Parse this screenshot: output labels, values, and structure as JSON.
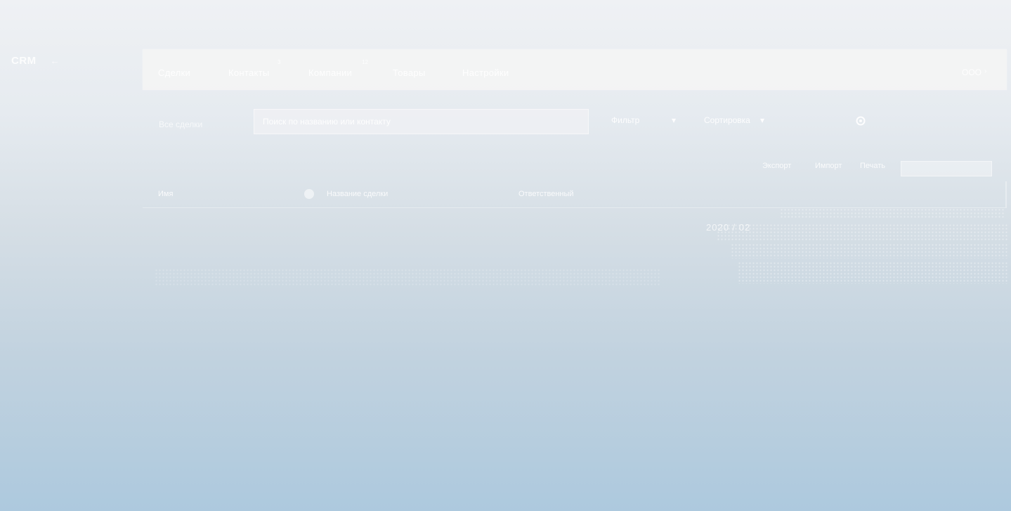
{
  "app": {
    "logo_text": "CRM",
    "logo_arrow": "←"
  },
  "nav": {
    "tabs": [
      {
        "label": "Сделки"
      },
      {
        "label": "Контакты"
      },
      {
        "label": "Компании"
      },
      {
        "label": "Товары"
      },
      {
        "label": "Настройки"
      }
    ],
    "badges": [
      "3",
      "12"
    ],
    "user_label": "ООО",
    "user_caret": "›"
  },
  "toolbar": {
    "label": "Все сделки",
    "search_placeholder": "Поиск по названию или контакту",
    "filter_label": "Фильтр",
    "filter_caret": "▾",
    "sort_label": "Сортировка",
    "sort_caret": "▾",
    "settings_icon": "gear-icon"
  },
  "subbar": {
    "links": [
      "Экспорт",
      "Импорт",
      "Печать"
    ],
    "button_label": ""
  },
  "row": {
    "col1": "Имя",
    "col2": "Название сделки",
    "col3": "Ответственный"
  },
  "faint_caption": "2020 / 02"
}
